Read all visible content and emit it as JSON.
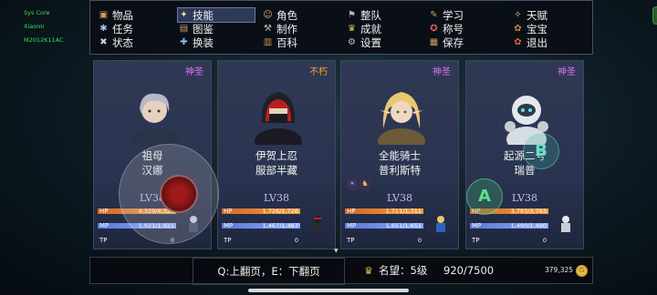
{
  "system": {
    "lines": [
      "Sys Core",
      "Xiaomi",
      "M2012K11AC"
    ]
  },
  "menu": {
    "items": [
      {
        "label": "物品",
        "icon": "bag-icon",
        "glyph": "▣",
        "color": "#d0a050"
      },
      {
        "label": "技能",
        "icon": "skill-icon",
        "glyph": "✦",
        "color": "#e8e0a0",
        "selected": true
      },
      {
        "label": "角色",
        "icon": "character-icon",
        "glyph": "☺",
        "color": "#e0b080"
      },
      {
        "label": "整队",
        "icon": "formation-icon",
        "glyph": "⚑",
        "color": "#b0b0d0"
      },
      {
        "label": "学习",
        "icon": "study-icon",
        "glyph": "✎",
        "color": "#d0a060"
      },
      {
        "label": "天赋",
        "icon": "talent-icon",
        "glyph": "✧",
        "color": "#f0d060"
      },
      {
        "label": "任务",
        "icon": "quest-icon",
        "glyph": "✱",
        "color": "#a0c8f0"
      },
      {
        "label": "图鉴",
        "icon": "codex-icon",
        "glyph": "▤",
        "color": "#c0a070"
      },
      {
        "label": "制作",
        "icon": "craft-icon",
        "glyph": "⚒",
        "color": "#c0c0c0"
      },
      {
        "label": "成就",
        "icon": "achievement-icon",
        "glyph": "♛",
        "color": "#e0c060"
      },
      {
        "label": "称号",
        "icon": "title-icon",
        "glyph": "✪",
        "color": "#e06060"
      },
      {
        "label": "宝宝",
        "icon": "pet-icon",
        "glyph": "✿",
        "color": "#d08050"
      },
      {
        "label": "状态",
        "icon": "status-icon",
        "glyph": "✖",
        "color": "#d0d0d0"
      },
      {
        "label": "换装",
        "icon": "equip-icon",
        "glyph": "✚",
        "color": "#80c0f0"
      },
      {
        "label": "百科",
        "icon": "encyclopedia-icon",
        "glyph": "▥",
        "color": "#d09050"
      },
      {
        "label": "设置",
        "icon": "settings-icon",
        "glyph": "⚙",
        "color": "#c0c0c0"
      },
      {
        "label": "保存",
        "icon": "save-icon",
        "glyph": "▦",
        "color": "#d0a060"
      },
      {
        "label": "退出",
        "icon": "exit-icon",
        "glyph": "✿",
        "color": "#e06040"
      }
    ],
    "badge": "Game"
  },
  "party": [
    {
      "rank": "神圣",
      "rank_color": "#e070f0",
      "name1": "祖母",
      "name2": "汉娜",
      "level": "LV38",
      "hp": "4,329/4,329",
      "mp": "1,921/1,921",
      "tp": "0",
      "hp_frac": 1.0,
      "mp_frac": 1.0,
      "tp_frac": 0,
      "skills": []
    },
    {
      "rank": "不朽",
      "rank_color": "#f0a030",
      "name1": "伊贺上忍",
      "name2": "服部半藏",
      "level": "LV38",
      "hp": "1,726/1,726",
      "mp": "1,467/1,467",
      "tp": "0",
      "hp_frac": 1.0,
      "mp_frac": 1.0,
      "tp_frac": 0,
      "skills": []
    },
    {
      "rank": "神圣",
      "rank_color": "#e070f0",
      "name1": "全能骑士",
      "name2": "普利斯特",
      "level": "LV38",
      "hp": "1,711/1,711",
      "mp": "1,651/1,651",
      "tp": "0",
      "hp_frac": 1.0,
      "mp_frac": 1.0,
      "tp_frac": 0,
      "skills": [
        {
          "icon": "buff-icon-1",
          "glyph": "✶",
          "color": "#a080f0"
        },
        {
          "icon": "buff-icon-2",
          "glyph": "♞",
          "color": "#f0c050"
        }
      ]
    },
    {
      "rank": "神圣",
      "rank_color": "#e070f0",
      "name1": "起源二号",
      "name2": "瑞普",
      "level": "LV38",
      "hp": "3,793/3,793",
      "mp": "1,490/1,490",
      "tp": "0",
      "hp_frac": 1.0,
      "mp_frac": 1.0,
      "tp_frac": 0,
      "skills": []
    }
  ],
  "stat_labels": {
    "hp": "HP",
    "mp": "MP",
    "tp": "TP"
  },
  "controls": {
    "a": "A",
    "b": "B"
  },
  "bottom": {
    "page_hint": "Q:上翻页，E：下翻页",
    "reputation": "名望：5级",
    "progress": "920/7500",
    "gold": "379,325"
  }
}
